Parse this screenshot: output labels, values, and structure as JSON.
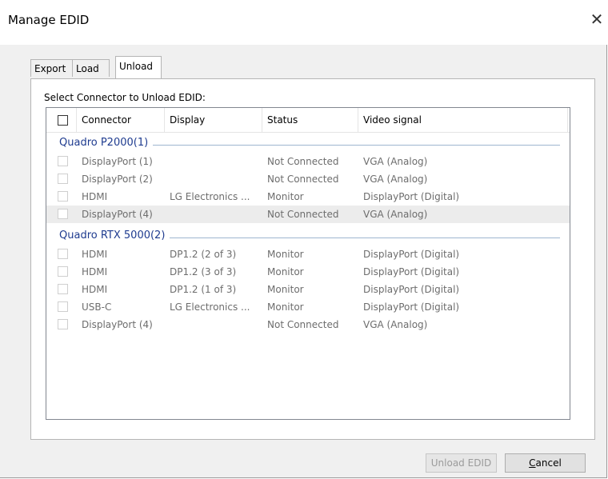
{
  "window": {
    "title": "Manage EDID",
    "close_symbol": "✕"
  },
  "tabs": [
    {
      "label": "Export",
      "active": false
    },
    {
      "label": "Load",
      "active": false
    },
    {
      "label": "Unload",
      "active": true
    }
  ],
  "select_label": "Select Connector to Unload EDID:",
  "columns": [
    "Connector",
    "Display",
    "Status",
    "Video signal"
  ],
  "groups": [
    {
      "title": "Quadro P2000(1)",
      "rows": [
        {
          "connector": "DisplayPort (1)",
          "display": "",
          "status": "Not Connected",
          "video": "VGA (Analog)",
          "highlight": false
        },
        {
          "connector": "DisplayPort (2)",
          "display": "",
          "status": "Not Connected",
          "video": "VGA (Analog)",
          "highlight": false
        },
        {
          "connector": "HDMI",
          "display": "LG Electronics ...",
          "status": "Monitor",
          "video": "DisplayPort (Digital)",
          "highlight": false
        },
        {
          "connector": "DisplayPort (4)",
          "display": "",
          "status": "Not Connected",
          "video": "VGA (Analog)",
          "highlight": true
        }
      ]
    },
    {
      "title": "Quadro RTX 5000(2)",
      "rows": [
        {
          "connector": "HDMI",
          "display": "DP1.2 (2 of 3)",
          "status": "Monitor",
          "video": "DisplayPort (Digital)",
          "highlight": false
        },
        {
          "connector": "HDMI",
          "display": "DP1.2 (3 of 3)",
          "status": "Monitor",
          "video": "DisplayPort (Digital)",
          "highlight": false
        },
        {
          "connector": "HDMI",
          "display": "DP1.2 (1 of 3)",
          "status": "Monitor",
          "video": "DisplayPort (Digital)",
          "highlight": false
        },
        {
          "connector": "USB-C",
          "display": "LG Electronics ...",
          "status": "Monitor",
          "video": "DisplayPort (Digital)",
          "highlight": false
        },
        {
          "connector": "DisplayPort (4)",
          "display": "",
          "status": "Not Connected",
          "video": "VGA (Analog)",
          "highlight": false
        }
      ]
    }
  ],
  "buttons": {
    "unload": {
      "label": "Unload EDID",
      "enabled": false
    },
    "cancel": {
      "mnemonic": "C",
      "rest": "ancel"
    }
  },
  "colors": {
    "group_title": "#1e3b8f",
    "disabled_text": "#6d6d6d",
    "row_highlight": "#ececec"
  }
}
